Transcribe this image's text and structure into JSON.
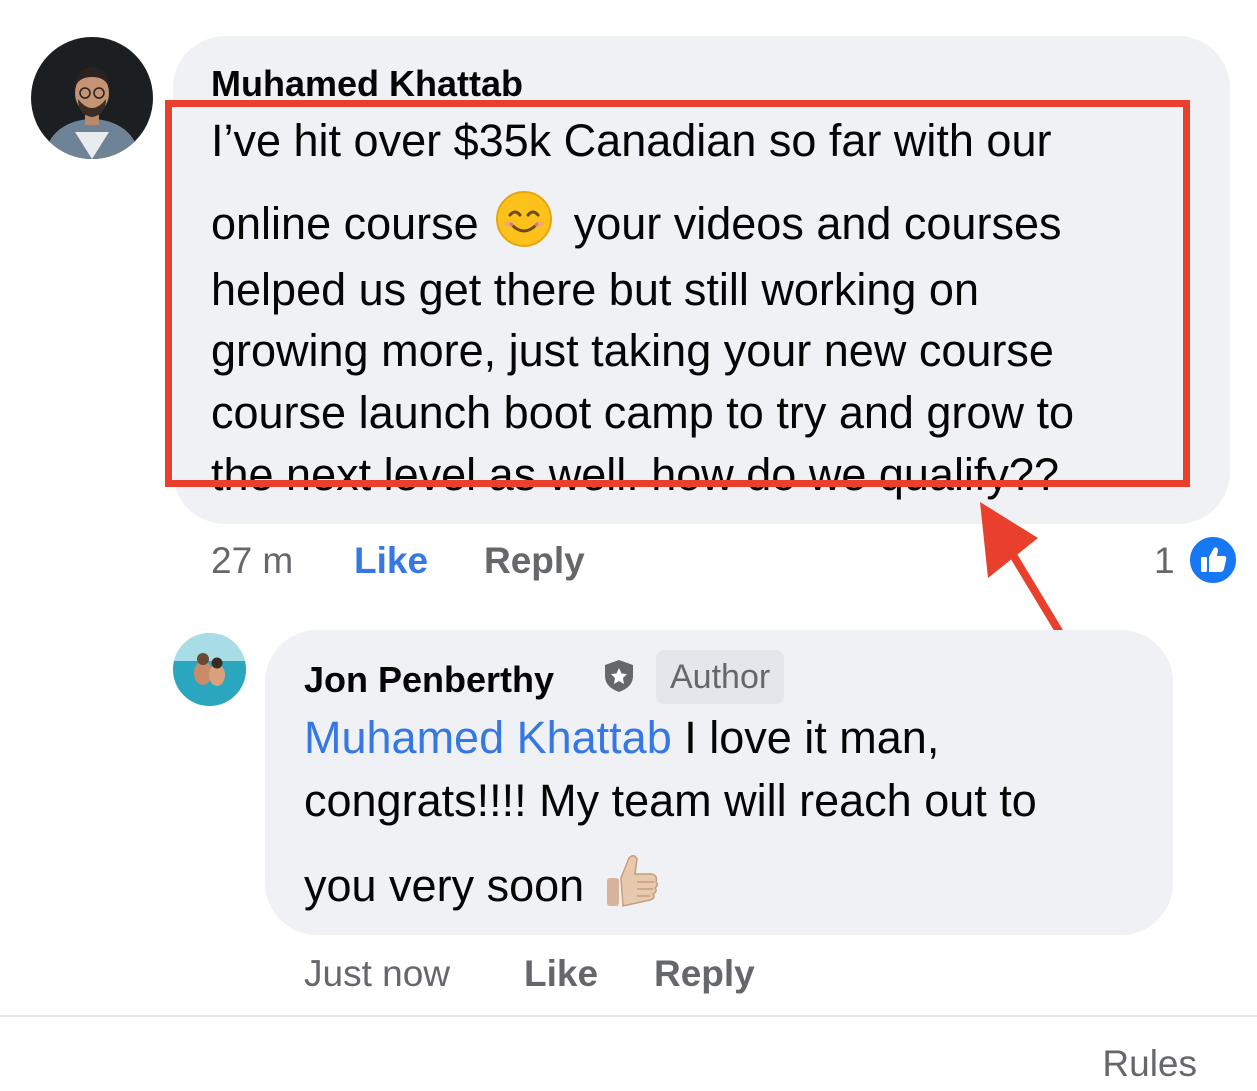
{
  "comment": {
    "author": "Muhamed Khattab",
    "lines": [
      "I’ve hit over $35k Canadian so far with our",
      "online course",
      "your videos and courses",
      "helped us get there but still working on",
      "growing more, just taking your new course",
      "course launch boot camp to try and grow to",
      "the next level as well. how do  we qualify??"
    ],
    "emoji_icon": "smiling-face-emoji",
    "time": "27 m",
    "like_label": "Like",
    "reply_label": "Reply",
    "reaction_count": "1",
    "reaction_icon": "thumbs-up-reaction-icon",
    "like_color": "#3578e5"
  },
  "reply": {
    "author": "Jon Penberthy",
    "badge_icon": "shield-badge-icon",
    "author_badge": "Author",
    "mention": "Muhamed Khattab",
    "line1_rest": " I love it man,",
    "line2": "congrats!!!! My team will reach out to",
    "line3": "you very soon",
    "emoji_icon": "thumbs-up-emoji",
    "time": "Just now",
    "like_label": "Like",
    "reply_label": "Reply"
  },
  "annotation": {
    "color": "#e8402d"
  },
  "footer": {
    "rules_label": "Rules"
  }
}
